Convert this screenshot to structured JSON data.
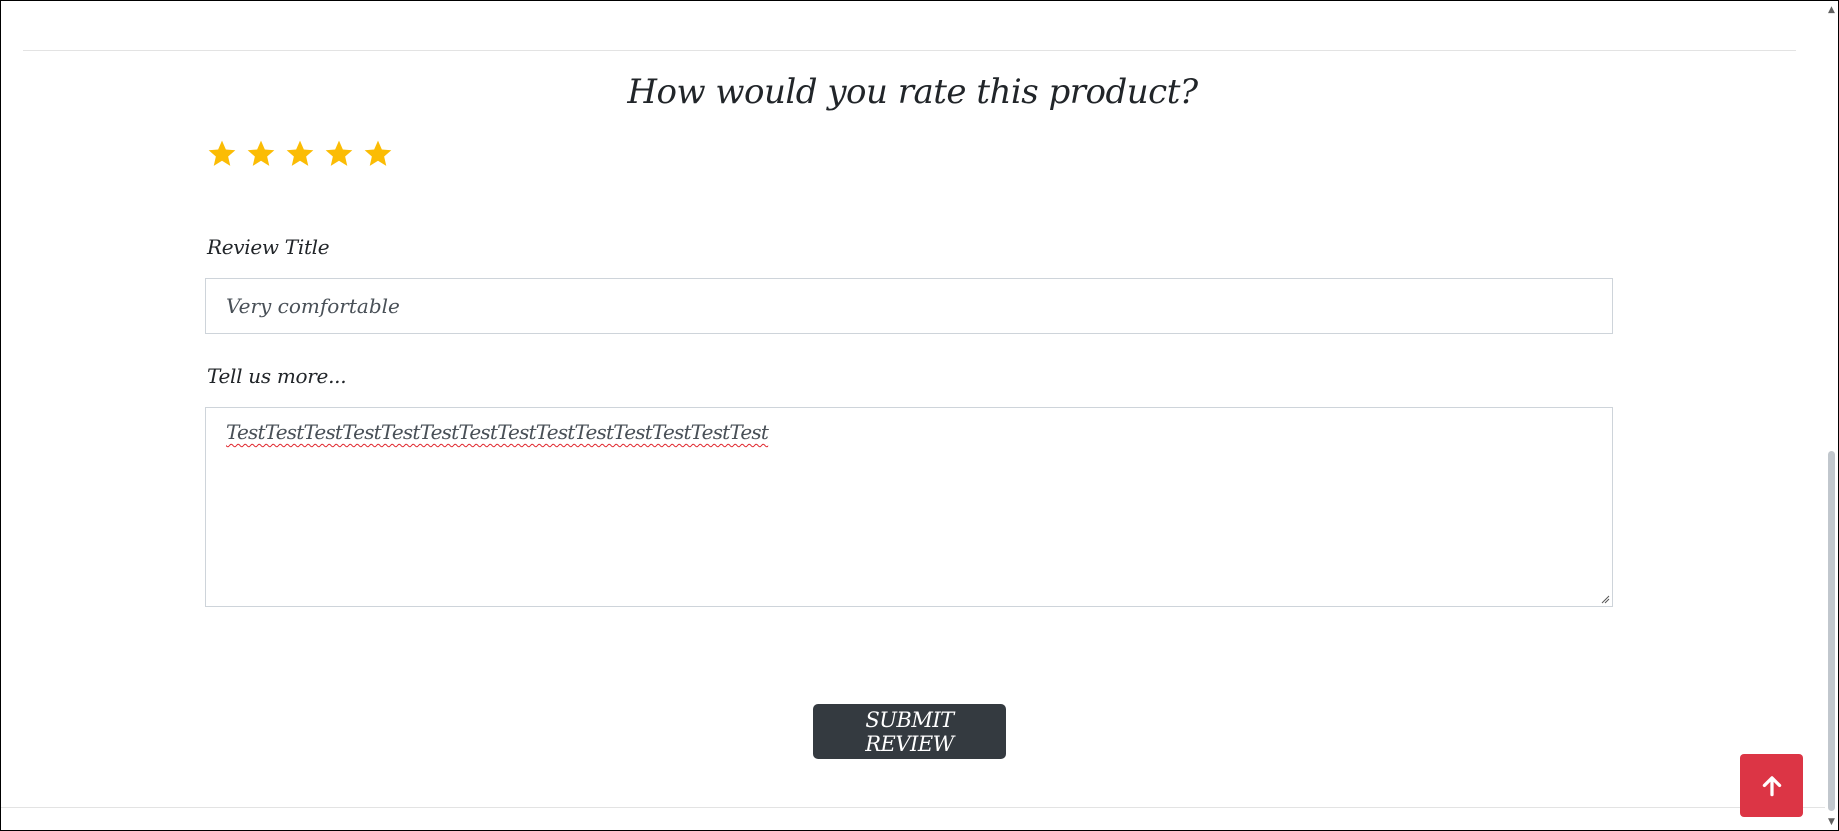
{
  "review_form": {
    "heading": "How would you rate this product?",
    "rating": {
      "value": 5,
      "max": 5,
      "star_color": "#fbbc04"
    },
    "title_label": "Review Title",
    "title_value": "Very comfortable",
    "body_label": "Tell us more...",
    "body_value": "TestTestTestTestTestTestTestTestTestTestTestTestTestTest",
    "submit_label": "SUBMIT REVIEW"
  },
  "back_to_top": {
    "icon": "arrow-up-icon",
    "color": "#dc3545"
  },
  "colors": {
    "button_dark": "#343a40",
    "border": "#ced4da",
    "spellcheck_underline": "#e0242b"
  }
}
